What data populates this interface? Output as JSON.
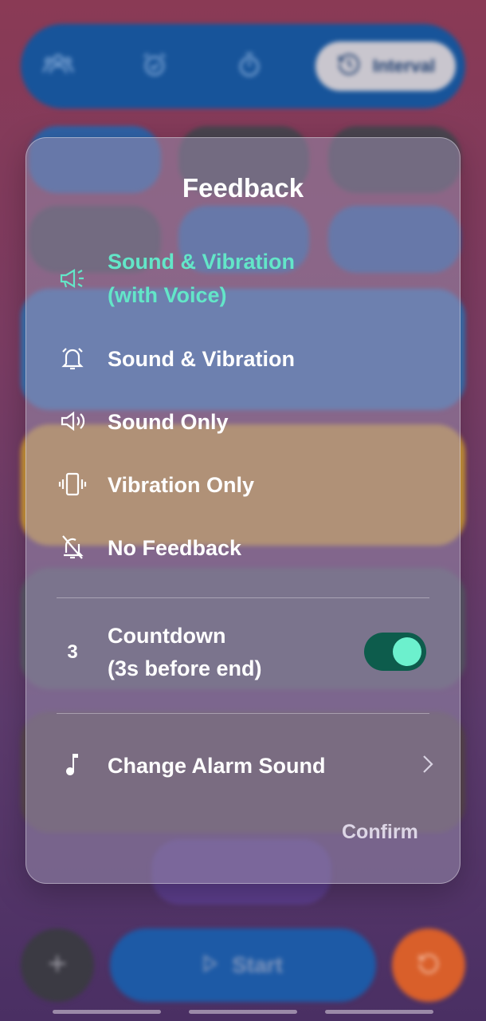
{
  "nav": {
    "tabs": [
      {
        "icon": "group-icon"
      },
      {
        "icon": "alarm-icon"
      },
      {
        "icon": "stopwatch-icon"
      },
      {
        "icon": "interval-icon",
        "label": "Interval",
        "selected": true
      }
    ]
  },
  "bottom_bar": {
    "add_icon": "plus-icon",
    "start_label": "Start",
    "reset_icon": "reset-icon"
  },
  "dialog": {
    "title": "Feedback",
    "options": [
      {
        "icon": "megaphone-icon",
        "line1": "Sound & Vibration",
        "line2": "(with Voice)",
        "selected": true
      },
      {
        "icon": "bell-icon",
        "label": "Sound & Vibration",
        "selected": false
      },
      {
        "icon": "speaker-icon",
        "label": "Sound Only",
        "selected": false
      },
      {
        "icon": "vibrate-icon",
        "label": "Vibration Only",
        "selected": false
      },
      {
        "icon": "bell-off-icon",
        "label": "No Feedback",
        "selected": false
      }
    ],
    "countdown": {
      "icon_glyph": "3",
      "line1": "Countdown",
      "line2": "(3s before end)",
      "enabled": true
    },
    "alarm_sound": {
      "icon": "music-note-icon",
      "label": "Change Alarm Sound"
    },
    "confirm_label": "Confirm"
  },
  "colors": {
    "accent": "#63e6c8",
    "toggle_track": "#0d5c4c",
    "toggle_knob": "#6cf0cd",
    "nav_bg": "#17549a",
    "start_bg": "#1d5aa6",
    "reset_bg": "#d95f2a"
  }
}
